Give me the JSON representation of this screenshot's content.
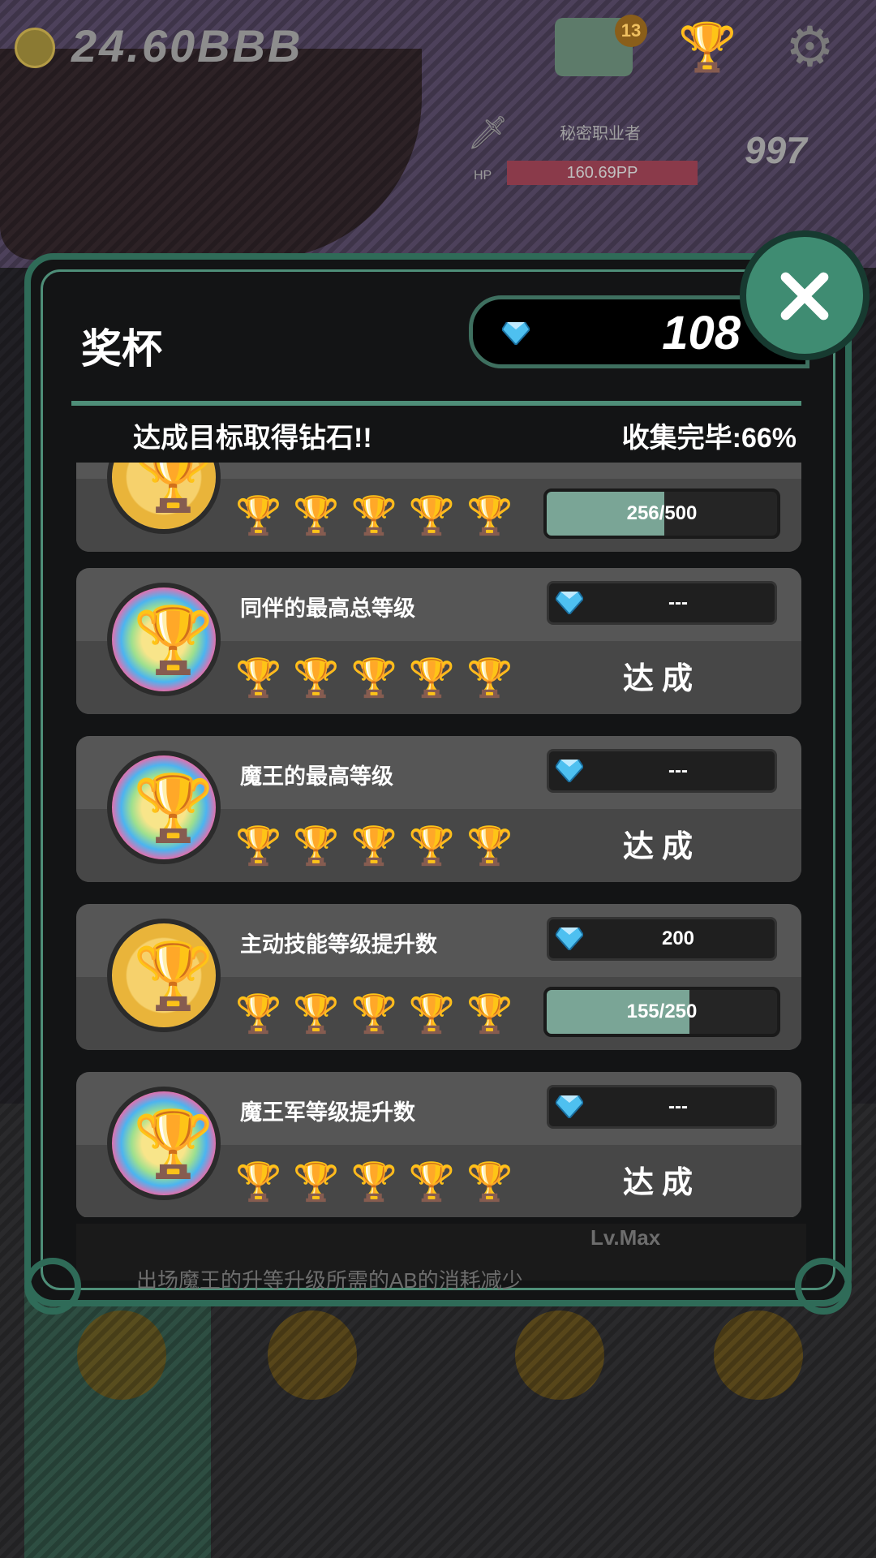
{
  "hud": {
    "money": "24.60BBB",
    "castle_badge": "13",
    "enemy_name": "秘密职业者",
    "hp_label": "HP",
    "hp_value": "160.69PP",
    "enemy_level": "997",
    "icons": [
      "coin-icon",
      "castle-icon",
      "trophy-icon",
      "gear-icon",
      "sword-icon"
    ]
  },
  "dialog": {
    "title": "奖杯",
    "gem_count": "108",
    "subtitle": "达成目标取得钻石!!",
    "completion": "收集完毕:66%",
    "close_icon": "close-icon"
  },
  "colors": {
    "frame": "#2f6b58",
    "accent": "#4e8e78",
    "progress_fill": "#7aa596",
    "trophy_gold": "#f0b030",
    "trophy_grey": "#bfbfbf"
  },
  "achievements": [
    {
      "title": "",
      "medal": "gold",
      "trophies_earned": 4,
      "trophies_total": 5,
      "reward": "",
      "progress_text": "256/500",
      "progress_fraction": 0.512,
      "status": ""
    },
    {
      "title": "同伴的最高总等级",
      "medal": "rainbow",
      "trophies_earned": 5,
      "trophies_total": 5,
      "reward": "---",
      "progress_text": "",
      "progress_fraction": null,
      "status": "达成"
    },
    {
      "title": "魔王的最高等级",
      "medal": "rainbow",
      "trophies_earned": 5,
      "trophies_total": 5,
      "reward": "---",
      "progress_text": "",
      "progress_fraction": null,
      "status": "达成"
    },
    {
      "title": "主动技能等级提升数",
      "medal": "gold",
      "trophies_earned": 4,
      "trophies_total": 5,
      "reward": "200",
      "progress_text": "155/250",
      "progress_fraction": 0.62,
      "status": ""
    },
    {
      "title": "魔王军等级提升数",
      "medal": "rainbow",
      "trophies_earned": 5,
      "trophies_total": 5,
      "reward": "---",
      "progress_text": "",
      "progress_fraction": null,
      "status": "达成"
    }
  ],
  "background_bottom": {
    "text": "出场魔王的升等升级所需的AB的消耗减少",
    "level": "Lv.Max"
  }
}
